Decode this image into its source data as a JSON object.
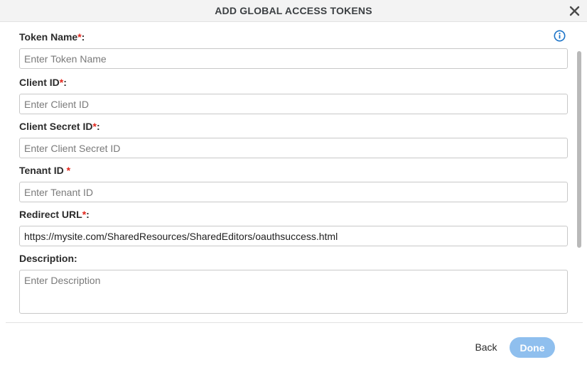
{
  "dialog": {
    "title": "ADD GLOBAL ACCESS TOKENS",
    "close_icon": "close-icon",
    "info_icon": "info-icon"
  },
  "fields": {
    "token_name": {
      "label": "Token Name",
      "required_mark": "*",
      "suffix": ":",
      "placeholder": "Enter Token Name",
      "value": ""
    },
    "client_id": {
      "label": "Client ID",
      "required_mark": "*",
      "suffix": ":",
      "placeholder": "Enter Client ID",
      "value": ""
    },
    "client_secret_id": {
      "label": "Client Secret ID",
      "required_mark": "*",
      "suffix": ":",
      "placeholder": "Enter Client Secret ID",
      "value": ""
    },
    "tenant_id": {
      "label": "Tenant ID ",
      "required_mark": "*",
      "suffix": "",
      "placeholder": "Enter Tenant ID",
      "value": ""
    },
    "redirect_url": {
      "label": "Redirect URL",
      "required_mark": "*",
      "suffix": ":",
      "placeholder": "",
      "value": "https://mysite.com/SharedResources/SharedEditors/oauthsuccess.html"
    },
    "description": {
      "label": "Description:",
      "placeholder": "Enter Description",
      "value": ""
    }
  },
  "footer": {
    "back_label": "Back",
    "done_label": "Done"
  },
  "colors": {
    "required": "#e1251b",
    "accent": "#1a73c8",
    "done_button_disabled": "#8fbfee"
  }
}
